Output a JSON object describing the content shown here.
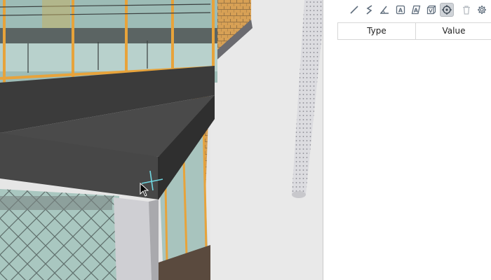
{
  "toolbar": {
    "tools": [
      {
        "name": "line-measure",
        "icon": "diagonal-line-icon",
        "active": false
      },
      {
        "name": "polyline-measure",
        "icon": "zigzag-line-icon",
        "active": false
      },
      {
        "name": "angle-measure",
        "icon": "angle-icon",
        "active": false
      },
      {
        "name": "area-measure",
        "icon": "area-box-icon",
        "active": false
      },
      {
        "name": "surface-area-measure",
        "icon": "surface-area-icon",
        "active": false
      },
      {
        "name": "volume-measure",
        "icon": "volume-box-icon",
        "active": false
      },
      {
        "name": "point-measure",
        "icon": "crosshair-target-icon",
        "active": true
      },
      {
        "name": "delete",
        "icon": "trash-icon",
        "active": false
      },
      {
        "name": "settings",
        "icon": "gear-icon",
        "active": false
      }
    ],
    "area_glyph": "A",
    "volume_glyph": "V",
    "accent": "#5f6d7c"
  },
  "measurements_table": {
    "type_header": "Type",
    "value_header": "Value",
    "rows": []
  },
  "viewport": {
    "scene": "3d-building-model",
    "cursor": "arrow-cursor-icon",
    "snap_marker": "snap-crosshair-icon",
    "snap_color": "#6fd6e0"
  }
}
